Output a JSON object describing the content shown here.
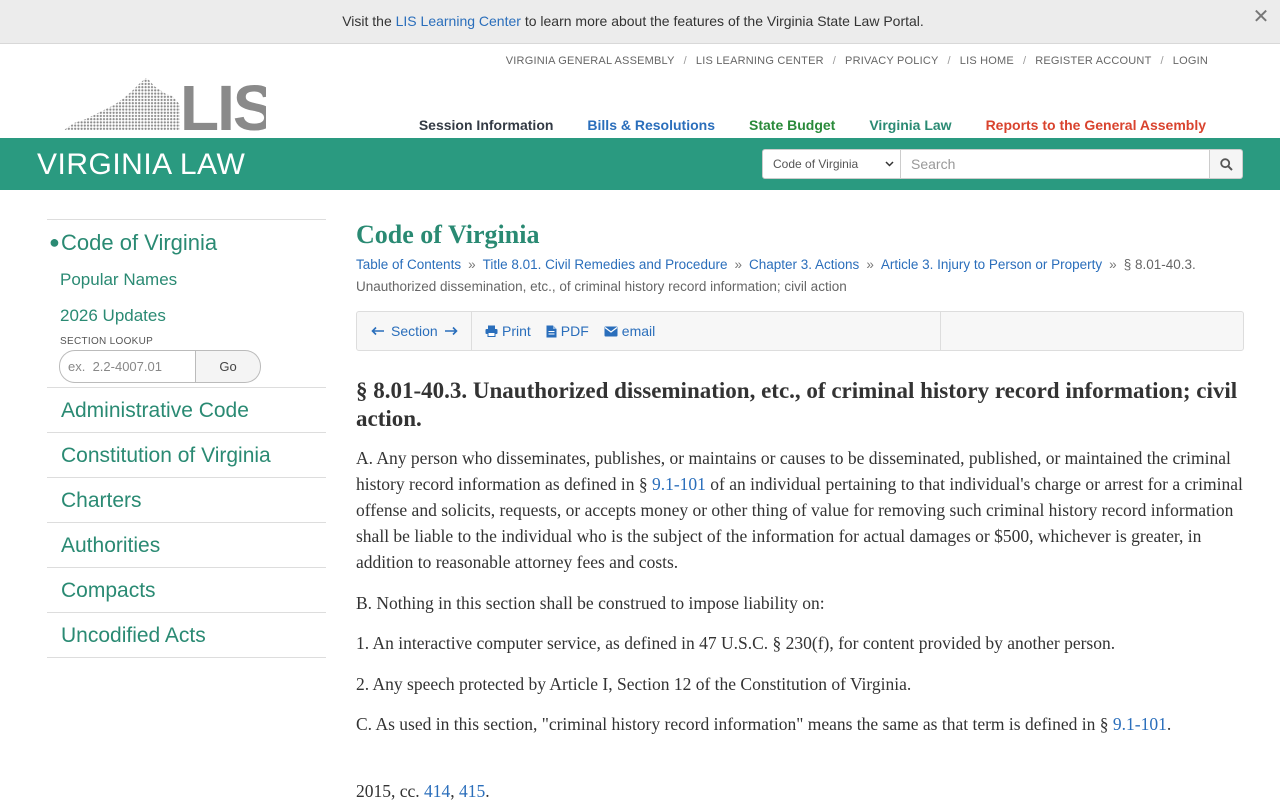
{
  "banner": {
    "prefix": "Visit the ",
    "link": "LIS Learning Center",
    "suffix": " to learn more about the features of the Virginia State Law Portal.",
    "close": "✕"
  },
  "utility_nav": [
    "VIRGINIA GENERAL ASSEMBLY",
    "LIS LEARNING CENTER",
    "PRIVACY POLICY",
    "LIS HOME",
    "REGISTER ACCOUNT",
    "LOGIN"
  ],
  "utility_sep": "/",
  "logo_text": "LIS",
  "main_nav": [
    {
      "label": "Session Information",
      "color": "#333a44"
    },
    {
      "label": "Bills & Resolutions",
      "color": "#2a6ebb"
    },
    {
      "label": "State Budget",
      "color": "#2a8a3a"
    },
    {
      "label": "Virginia Law",
      "color": "#2a8a73"
    },
    {
      "label": "Reports to the General Assembly",
      "color": "#d9432e"
    }
  ],
  "greenbar": {
    "title": "VIRGINIA LAW",
    "select_value": "Code of Virginia",
    "search_placeholder": "Search",
    "accent": "#2a9a80"
  },
  "sidebar": {
    "active": "Code of Virginia",
    "sub": [
      "Popular Names",
      "2026 Updates"
    ],
    "lookup_label": "SECTION LOOKUP",
    "lookup_placeholder": "ex.  2.2-4007.01",
    "go": "Go",
    "items": [
      "Administrative Code",
      "Constitution of Virginia",
      "Charters",
      "Authorities",
      "Compacts",
      "Uncodified Acts"
    ]
  },
  "main": {
    "title": "Code of Virginia",
    "breadcrumb": [
      "Table of Contents",
      "Title 8.01. Civil Remedies and Procedure",
      "Chapter 3. Actions",
      "Article 3. Injury to Person or Property"
    ],
    "breadcrumb_current": "§ 8.01-40.3. Unauthorized dissemination, etc., of criminal history record information; civil action",
    "breadcrumb_sep": "»",
    "toolbar": {
      "section": "Section",
      "print": "Print",
      "pdf": "PDF",
      "email": "email"
    },
    "heading": "§ 8.01-40.3. Unauthorized dissemination, etc., of criminal history record information; civil action.",
    "para_a_1": "A. Any person who disseminates, publishes, or maintains or causes to be disseminated, published, or maintained the criminal history record information as defined in § ",
    "para_a_link": "9.1-101",
    "para_a_2": " of an individual pertaining to that individual's charge or arrest for a criminal offense and solicits, requests, or accepts money or other thing of value for removing such criminal history record information shall be liable to the individual who is the subject of the information for actual damages or $500, whichever is greater, in addition to reasonable attorney fees and costs.",
    "para_b": "B. Nothing in this section shall be construed to impose liability on:",
    "para_1": "1. An interactive computer service, as defined in 47 U.S.C. § 230(f), for content provided by another person.",
    "para_2": "2. Any speech protected by Article I, Section 12 of the Constitution of Virginia.",
    "para_c_1": "C. As used in this section, \"criminal history record information\" means the same as that term is defined in § ",
    "para_c_link": "9.1-101",
    "para_c_2": ".",
    "history_prefix": "2015, cc. ",
    "history_link1": "414",
    "history_comma": ", ",
    "history_link2": "415",
    "history_end": "."
  }
}
